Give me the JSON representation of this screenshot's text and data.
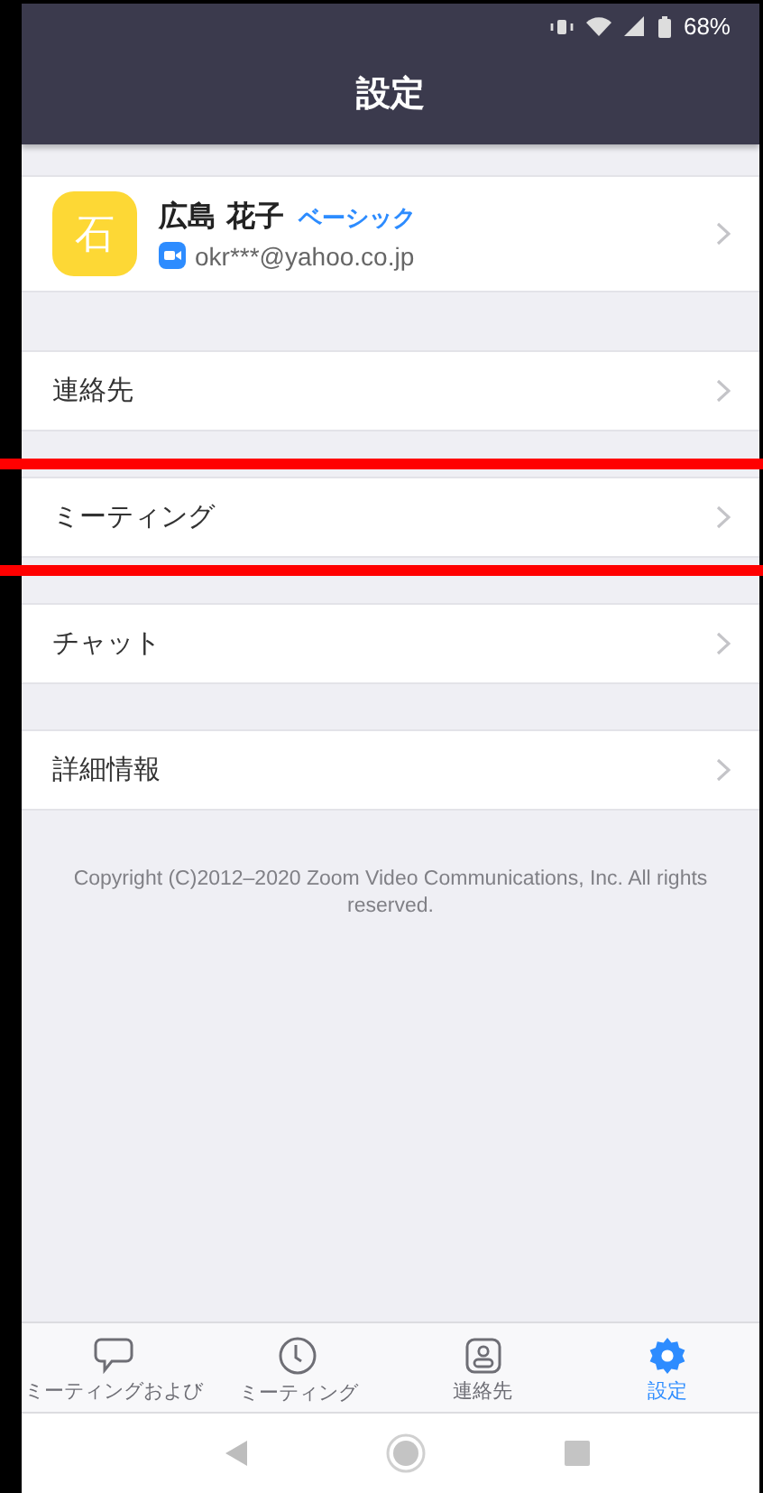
{
  "status_bar": {
    "battery": "68%"
  },
  "header": {
    "title": "設定"
  },
  "profile": {
    "avatar_text": "石",
    "name": "広島 花子",
    "plan": "ベーシック",
    "email": "okr***@yahoo.co.jp"
  },
  "menu": [
    {
      "label": "連絡先",
      "highlighted": false
    },
    {
      "label": "ミーティング",
      "highlighted": true
    },
    {
      "label": "チャット",
      "highlighted": false
    },
    {
      "label": "詳細情報",
      "highlighted": false
    }
  ],
  "copyright": "Copyright (C)2012–2020 Zoom Video Communications, Inc. All rights reserved.",
  "tabs": [
    {
      "label": "ミーティングおよび",
      "kind": "chat",
      "selected": false
    },
    {
      "label": "ミーティング",
      "kind": "clock",
      "selected": false
    },
    {
      "label": "連絡先",
      "kind": "contact",
      "selected": false
    },
    {
      "label": "設定",
      "kind": "gear",
      "selected": true
    }
  ]
}
